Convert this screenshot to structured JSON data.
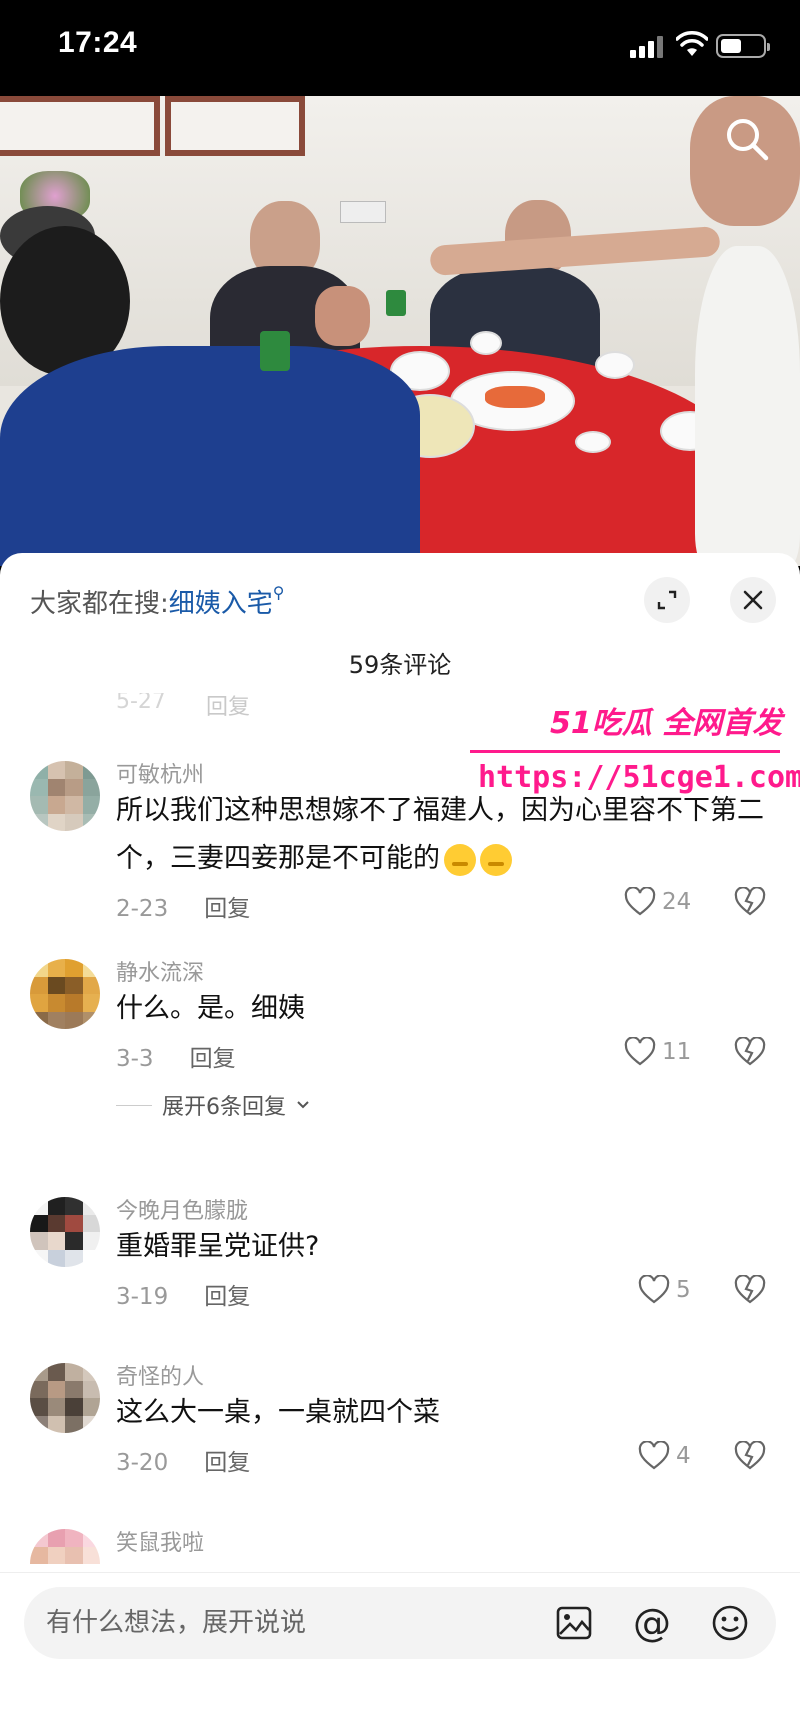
{
  "status_bar": {
    "time": "17:24"
  },
  "video": {
    "search_icon": "search-icon"
  },
  "panel": {
    "search_prefix": "大家都在搜:",
    "search_keyword": "细姨入宅",
    "search_symbol": "⚲",
    "comment_count": "59条评论"
  },
  "faded_row": {
    "date": "5-27",
    "reply": "回复"
  },
  "comments": [
    {
      "user": "可敏杭州",
      "text": "所以我们这种思想嫁不了福建人，因为心里容不下第二个，三妻四妾那是不可能的",
      "date": "2-23",
      "reply": "回复",
      "likes": "24"
    },
    {
      "user": "静水流深",
      "text": "什么。是。细姨",
      "date": "3-3",
      "reply": "回复",
      "likes": "11",
      "expand": "展开6条回复"
    },
    {
      "user": "今晚月色朦胧",
      "text": "重婚罪呈党证供?",
      "date": "3-19",
      "reply": "回复",
      "likes": "5"
    },
    {
      "user": "奇怪的人",
      "text": "这么大一桌，一桌就四个菜",
      "date": "3-20",
      "reply": "回复",
      "likes": "4"
    },
    {
      "user": "笑鼠我啦"
    }
  ],
  "watermark": {
    "top": "51吃瓜 全网首发",
    "url": "https://51cge1.com"
  },
  "input_bar": {
    "placeholder": "有什么想法，展开说说"
  },
  "colors": {
    "accent_link": "#1a5aa8",
    "watermark": "#ff1a8c",
    "table": "#d8262a"
  }
}
